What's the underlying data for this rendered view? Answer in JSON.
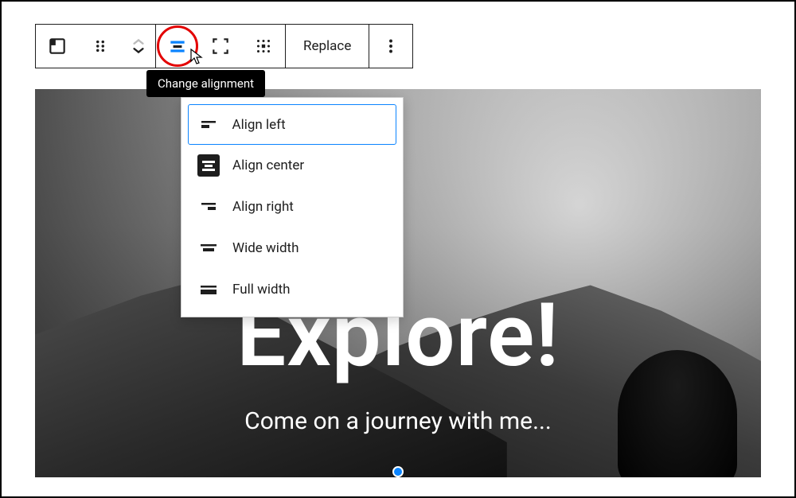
{
  "hero": {
    "title": "Explore!",
    "subtitle": "Come on a journey with me..."
  },
  "toolbar": {
    "replace_label": "Replace",
    "tooltip": "Change alignment"
  },
  "align_menu": {
    "items": [
      {
        "label": "Align left"
      },
      {
        "label": "Align center"
      },
      {
        "label": "Align right"
      },
      {
        "label": "Wide width"
      },
      {
        "label": "Full width"
      }
    ]
  }
}
